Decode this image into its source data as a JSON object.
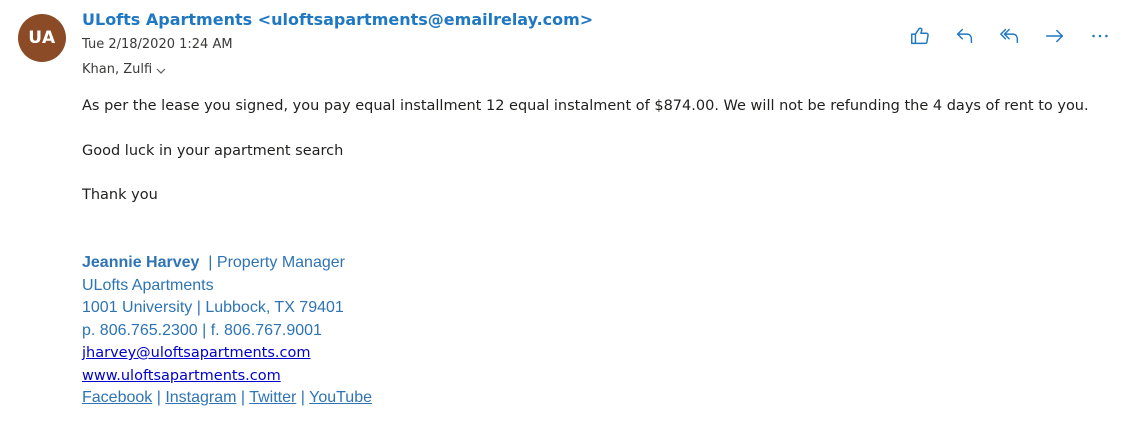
{
  "header": {
    "avatar_initials": "UA",
    "avatar_color": "#8a4b26",
    "sender": "ULofts Apartments <uloftsapartments@emailrelay.com>",
    "date": "Tue 2/18/2020 1:24 AM",
    "recipients": "Khan, Zulfi"
  },
  "toolbar": {
    "icons": [
      "like-icon",
      "reply-icon",
      "reply-all-icon",
      "forward-icon",
      "more-icon"
    ]
  },
  "body": {
    "paragraph1": "As per the lease you signed, you pay equal installment 12 equal instalment of $874.00.  We will not be refunding the 4 days of rent to you.",
    "paragraph2": "Good luck in your apartment search",
    "paragraph3": "Thank you"
  },
  "signature": {
    "name": "Jeannie Harvey",
    "title": "  | Property Manager",
    "company": "ULofts Apartments",
    "address": "1001 University | Lubbock, TX 79401",
    "phone": "p. 806.765.2300 | f. 806.767.9001",
    "email": "jharvey@uloftsapartments.com",
    "website": "www.uloftsapartments.com",
    "social": [
      "Facebook",
      "Instagram",
      "Twitter",
      "YouTube"
    ],
    "separator": " | "
  },
  "colors": {
    "accent": "#1f78c1",
    "signature": "#2e74b5",
    "link": "#0000cc"
  }
}
